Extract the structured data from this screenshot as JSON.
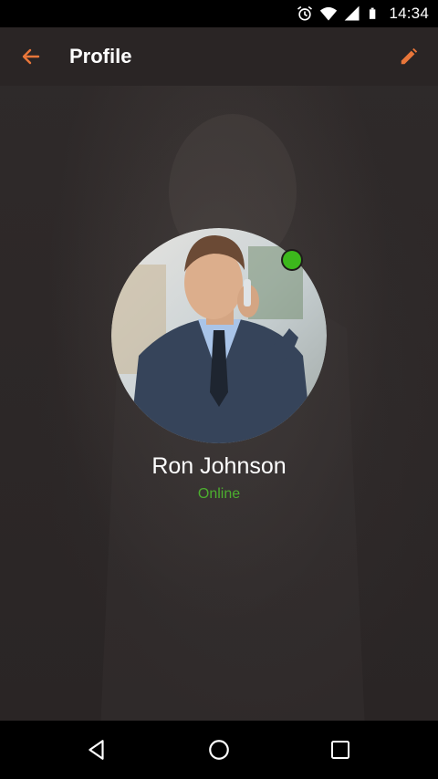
{
  "status_bar": {
    "time": "14:34",
    "icons": [
      "alarm-icon",
      "wifi-icon",
      "signal-icon",
      "battery-icon"
    ]
  },
  "app_bar": {
    "title": "Profile",
    "back_icon": "arrow-back-icon",
    "edit_icon": "pencil-icon"
  },
  "profile": {
    "name": "Ron Johnson",
    "status": "Online",
    "presence": "online"
  },
  "colors": {
    "accent": "#e8763a",
    "online": "#3cb81c",
    "background": "#2b2626"
  },
  "nav_bar": {
    "icons": [
      "nav-back-icon",
      "nav-home-icon",
      "nav-recents-icon"
    ]
  }
}
